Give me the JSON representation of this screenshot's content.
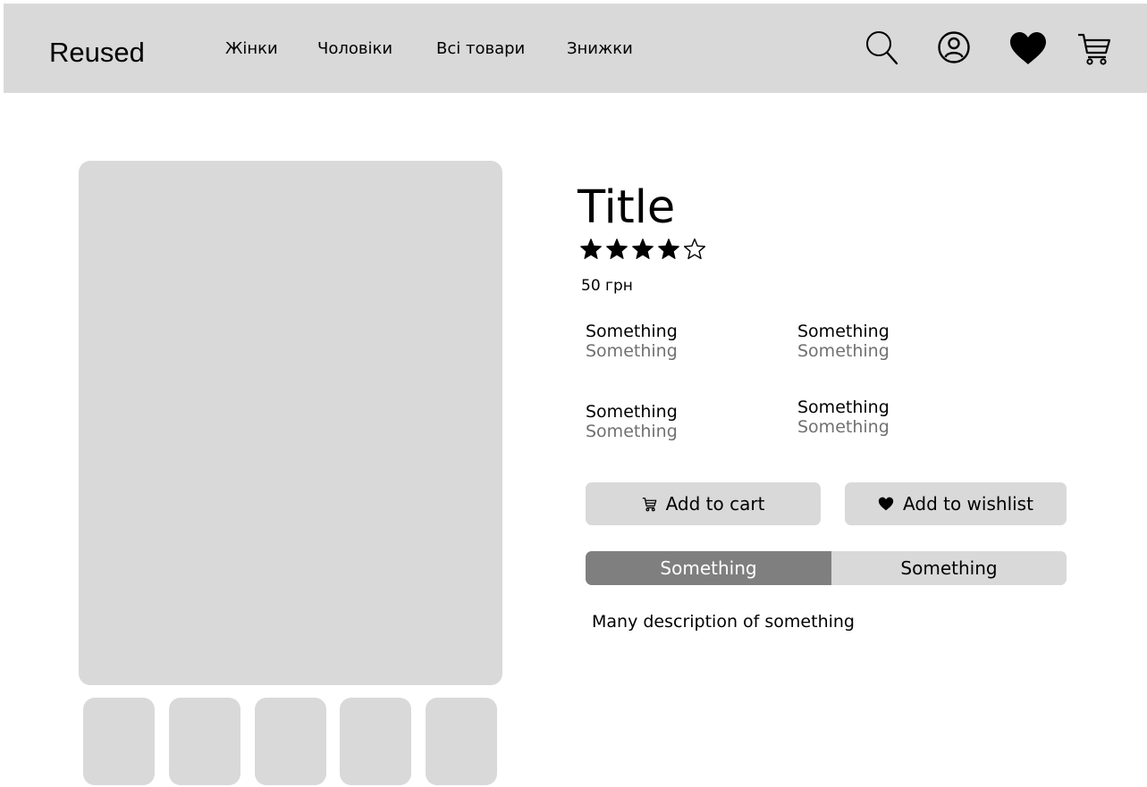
{
  "header": {
    "logo": "Reused",
    "nav": [
      "Жінки",
      "Чоловіки",
      "Всі товари",
      "Знижки"
    ],
    "icons": [
      "search-icon",
      "user-icon",
      "heart-icon",
      "cart-icon"
    ]
  },
  "product": {
    "title": "Title",
    "rating": 4,
    "rating_max": 5,
    "price": "50 грн",
    "attributes": [
      {
        "label": "Something",
        "value": "Something"
      },
      {
        "label": "Something",
        "value": "Something"
      },
      {
        "label": "Something",
        "value": "Something"
      },
      {
        "label": "Something",
        "value": "Something"
      }
    ],
    "add_to_cart": "Add to cart",
    "add_to_wishlist": "Add to wishlist",
    "tabs": [
      "Something",
      "Something"
    ],
    "description": "Many description of something"
  },
  "gallery": {
    "thumbnail_count": 5
  },
  "colors": {
    "placeholder": "#d9d9d9",
    "active_tab": "#7f7f7f",
    "secondary_text": "#707070"
  }
}
